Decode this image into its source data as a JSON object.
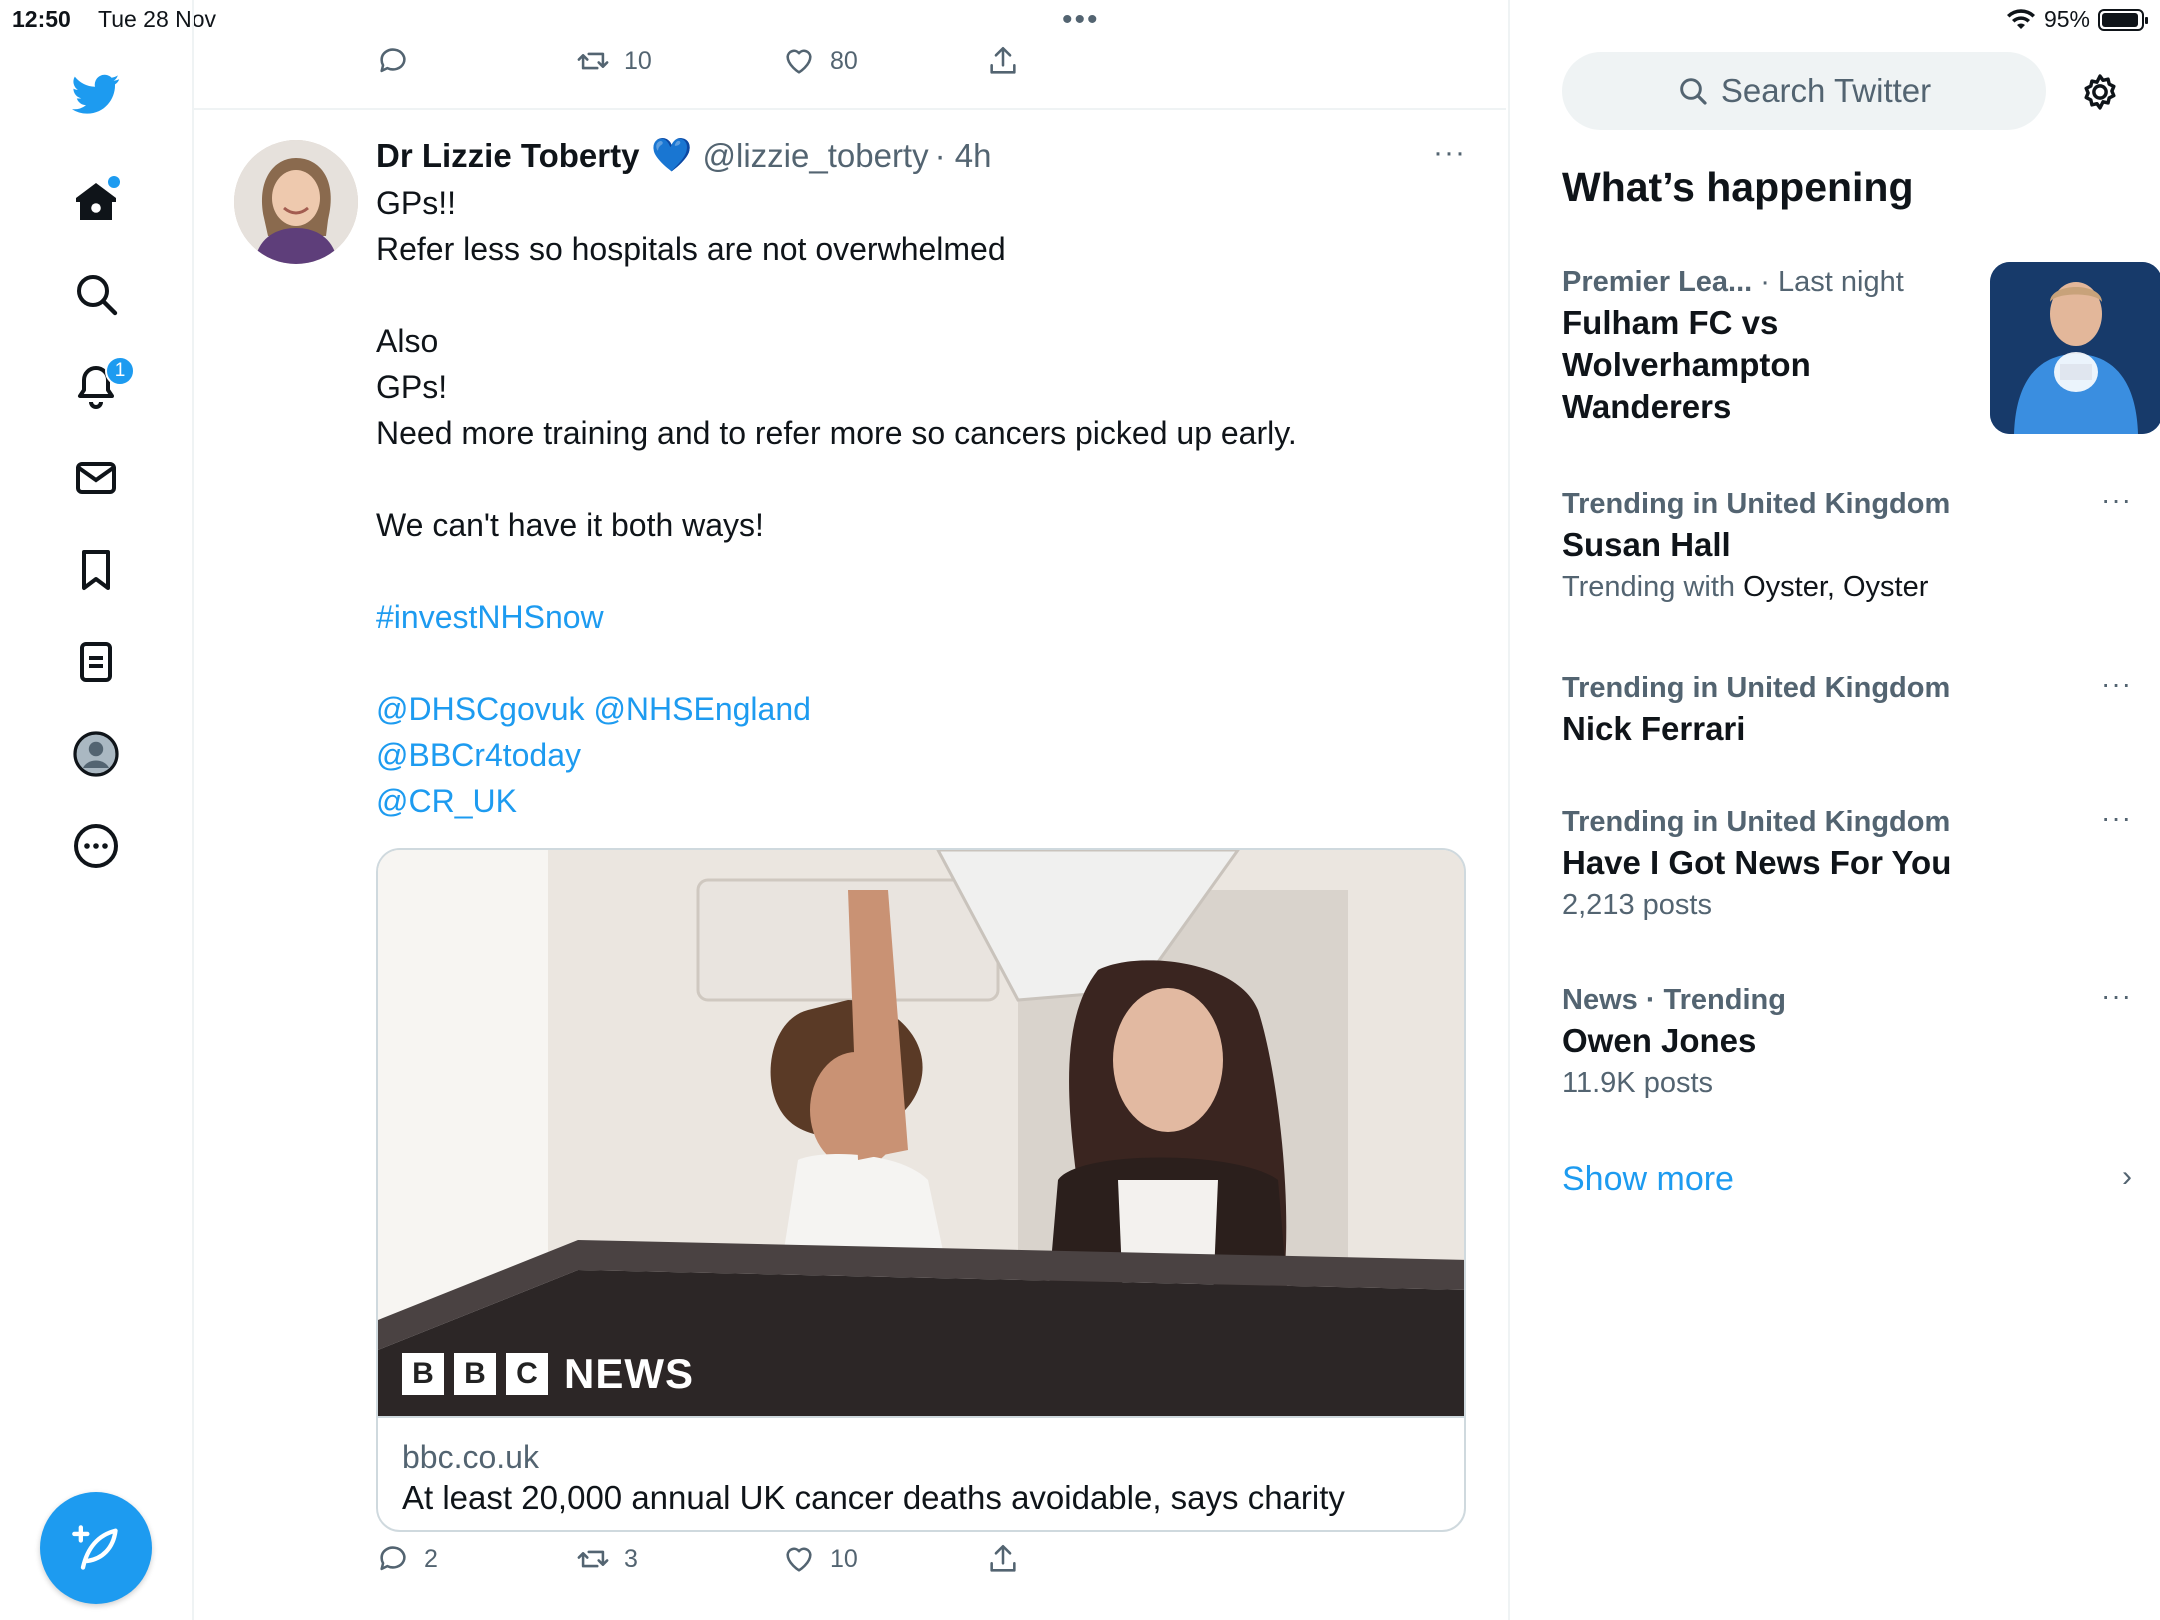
{
  "status": {
    "time": "12:50",
    "date": "Tue 28 Nov",
    "battery": "95%",
    "multitask": "•••"
  },
  "nav": {
    "notifications_badge": "1",
    "items": [
      "home",
      "explore",
      "notifications",
      "messages",
      "bookmarks",
      "lists",
      "profile",
      "more"
    ]
  },
  "prev_tweet": {
    "retweets": "10",
    "likes": "80"
  },
  "tweet": {
    "name": "Dr Lizzie Toberty",
    "verified_emoji": "💙",
    "handle": "@lizzie_toberty",
    "time": "· 4h",
    "more": "···",
    "lines": {
      "l1": "GPs!!",
      "l2": "Refer less so hospitals are not overwhelmed",
      "l3": "Also",
      "l4": "GPs!",
      "l5": "Need more training and to refer more so cancers picked up early.",
      "l6": "We can't have it both ways!",
      "hashtag": "#investNHSnow",
      "mention1": "@DHSCgovuk",
      "mention2": "@NHSEngland",
      "mention3": "@BBCr4today",
      "mention4": "@CR_UK"
    },
    "card": {
      "logo_b1": "B",
      "logo_b2": "B",
      "logo_c": "C",
      "logo_news": "NEWS",
      "domain": "bbc.co.uk",
      "title": "At least 20,000 annual UK cancer deaths avoidable, says charity"
    },
    "replies": "2",
    "retweets": "3",
    "likes": "10"
  },
  "sidebar": {
    "search_placeholder": "Search Twitter",
    "heading": "What’s happening",
    "trends": [
      {
        "category": "Premier Lea...",
        "time": "· Last night",
        "title": "Fulham FC vs Wolverhampton Wanderers"
      },
      {
        "category": "Trending in United Kingdom",
        "title": "Susan Hall",
        "sub_prefix": "Trending with",
        "sub_terms": "Oyster, Oyster"
      },
      {
        "category": "Trending in United Kingdom",
        "title": "Nick Ferrari"
      },
      {
        "category": "Trending in United Kingdom",
        "title": "Have I Got News For You",
        "posts": "2,213 posts"
      },
      {
        "category": "News · Trending",
        "title": "Owen Jones",
        "posts": "11.9K posts"
      }
    ],
    "more_label": "···",
    "show_more": "Show more",
    "chevron": "›"
  },
  "colors": {
    "accent": "#1d9bf0",
    "text": "#0f1419",
    "muted": "#536471",
    "border": "#eff3f4"
  }
}
